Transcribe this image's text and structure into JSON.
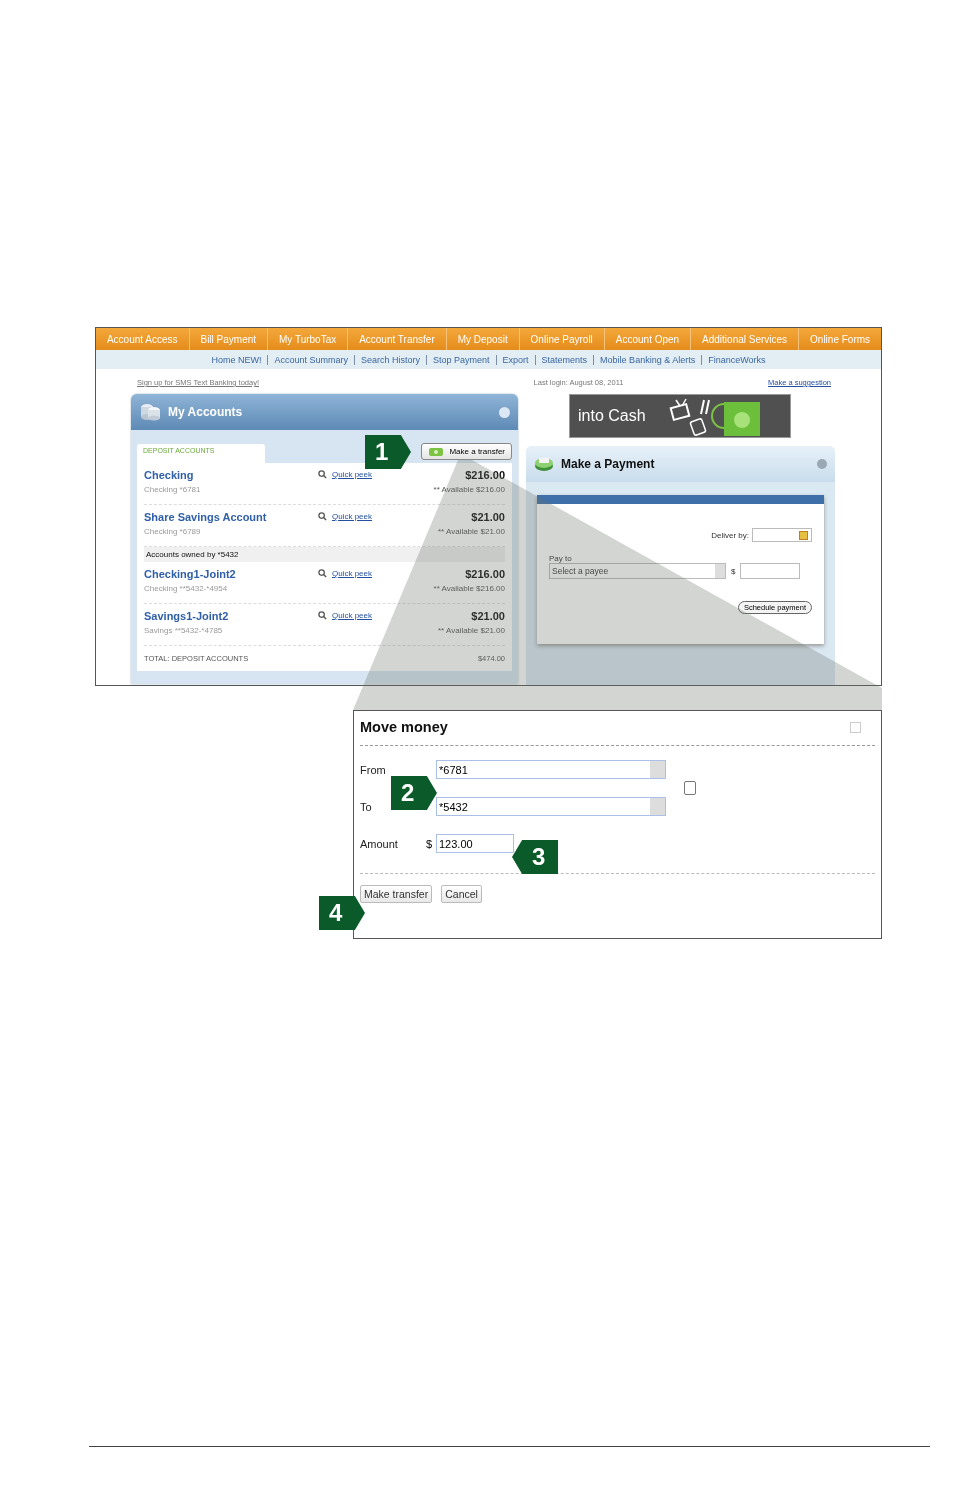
{
  "nav_tabs": [
    "Account Access",
    "Bill Payment",
    "My TurboTax",
    "Account Transfer",
    "My Deposit",
    "Online Payroll",
    "Account Open",
    "Additional Services",
    "Online Forms"
  ],
  "subnav": [
    "Home NEW!",
    "Account Summary",
    "Search History",
    "Stop Payment",
    "Export",
    "Statements",
    "Mobile Banking & Alerts",
    "FinanceWorks"
  ],
  "sms_link": "Sign up for SMS Text Banking today!",
  "last_login": "Last login: August 08, 2011",
  "suggestion_link": "Make a suggestion",
  "accounts_panel": {
    "title": "My Accounts",
    "tab": "DEPOSIT ACCOUNTS",
    "transfer_button": "Make a transfer",
    "rows": [
      {
        "kind": "account",
        "name": "Checking",
        "detail": "Checking *6781",
        "link": "Quick peek",
        "balance": "$216.00",
        "available": "** Available $216.00"
      },
      {
        "kind": "account",
        "name": "Share Savings Account",
        "detail": "Checking *6789",
        "link": "Quick peek",
        "balance": "$21.00",
        "available": "** Available $21.00"
      },
      {
        "kind": "group",
        "label": "Accounts owned by *5432"
      },
      {
        "kind": "account",
        "name": "Checking1-Joint2",
        "detail": "Checking **5432-*4954",
        "link": "Quick peek",
        "balance": "$216.00",
        "available": "** Available $216.00"
      },
      {
        "kind": "account",
        "name": "Savings1-Joint2",
        "detail": "Savings **5432-*4785",
        "link": "Quick peek",
        "balance": "$21.00",
        "available": "** Available $21.00"
      },
      {
        "kind": "total",
        "label": "TOTAL: DEPOSIT ACCOUNTS",
        "amount": "$474.00"
      }
    ]
  },
  "banner": {
    "text": "into Cash"
  },
  "payment_panel": {
    "title": "Make a Payment",
    "deliver_label": "Deliver by:",
    "pay_to_label": "Pay to",
    "payee_select": "Select a payee",
    "currency": "$",
    "button": "Schedule payment"
  },
  "dialog": {
    "title": "Move money",
    "from_label": "From",
    "from_value": "*6781",
    "to_label": "To",
    "to_value": "*5432",
    "amount_label": "Amount",
    "currency": "$",
    "amount_value": "123.00",
    "buttons": [
      "Make transfer",
      "Cancel"
    ]
  },
  "step_markers": [
    {
      "label": "1",
      "kind": "right"
    },
    {
      "label": "2",
      "kind": "right"
    },
    {
      "label": "3",
      "kind": "left"
    },
    {
      "label": "4",
      "kind": "right"
    }
  ]
}
